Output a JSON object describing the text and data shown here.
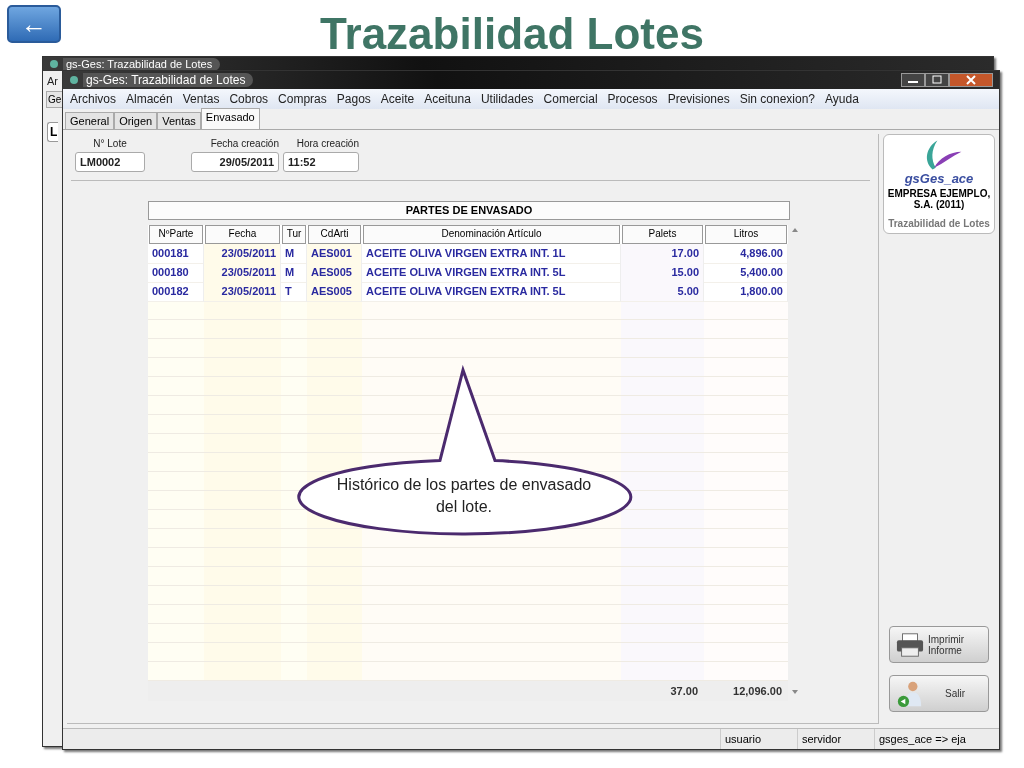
{
  "slide": {
    "back_button": "←",
    "title": "Trazabilidad Lotes"
  },
  "back_window": {
    "title": "gs-Ges: Trazabilidad de Lotes",
    "menu_fragment": "Ar",
    "tab_fragment": "Ge",
    "field_fragment": "L"
  },
  "window": {
    "title": "gs-Ges: Trazabilidad de Lotes"
  },
  "menu": [
    "Archivos",
    "Almacén",
    "Ventas",
    "Cobros",
    "Compras",
    "Pagos",
    "Aceite",
    "Aceituna",
    "Utilidades",
    "Comercial",
    "Procesos",
    "Previsiones",
    "Sin conexion?",
    "Ayuda"
  ],
  "tabs": [
    {
      "label": "General",
      "selected": false
    },
    {
      "label": "Origen",
      "selected": false
    },
    {
      "label": "Ventas",
      "selected": false
    },
    {
      "label": "Envasado",
      "selected": true
    }
  ],
  "fields": [
    {
      "label": "N° Lote",
      "value": "LM0002"
    },
    {
      "label": "Fecha creación",
      "value": "29/05/2011"
    },
    {
      "label": "Hora creación",
      "value": "11:52"
    }
  ],
  "grid": {
    "title": "PARTES DE ENVASADO",
    "columns": [
      "NºParte",
      "Fecha",
      "Tur",
      "CdArti",
      "Denominación Artículo",
      "Palets",
      "Litros"
    ],
    "rows": [
      [
        "000181",
        "23/05/2011",
        "M",
        "AES001",
        "ACEITE OLIVA VIRGEN EXTRA INT. 1L",
        "17.00",
        "4,896.00"
      ],
      [
        "000180",
        "23/05/2011",
        "M",
        "AES005",
        "ACEITE OLIVA VIRGEN EXTRA INT. 5L",
        "15.00",
        "5,400.00"
      ],
      [
        "000182",
        "23/05/2011",
        "T",
        "AES005",
        "ACEITE OLIVA VIRGEN EXTRA INT. 5L",
        "5.00",
        "1,800.00"
      ]
    ],
    "totals": {
      "palets": "37.00",
      "litros": "12,096.00"
    }
  },
  "sidebar": {
    "logo_text": "gsGes_ace",
    "company": "EMPRESA EJEMPLO, S.A. (2011)",
    "module": "Trazabilidad de Lotes",
    "buttons": [
      {
        "label": "Imprimir Informe",
        "kind": "print"
      },
      {
        "label": "Salir",
        "kind": "exit"
      }
    ]
  },
  "status_bar": [
    "usuario",
    "servidor",
    "gsges_ace => eja"
  ],
  "callout": {
    "text": "Histórico de los partes de envasado del lote."
  }
}
